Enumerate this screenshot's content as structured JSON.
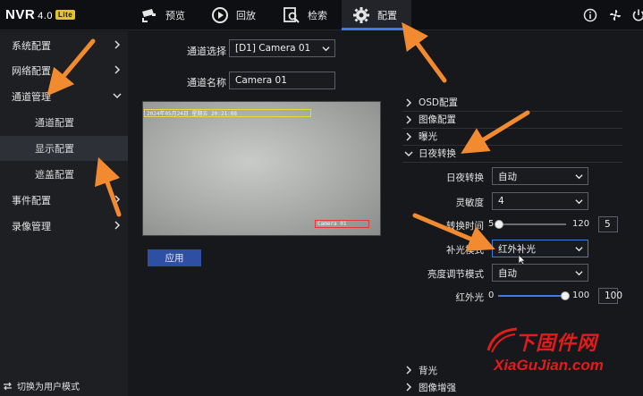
{
  "app": {
    "logo": "NVR",
    "version": "4.0",
    "edition": "Lite"
  },
  "topnav": {
    "tabs": [
      {
        "label": "预览",
        "icon": "camera-icon",
        "active": false
      },
      {
        "label": "回放",
        "icon": "playback-icon",
        "active": false
      },
      {
        "label": "检索",
        "icon": "search-doc-icon",
        "active": false
      },
      {
        "label": "配置",
        "icon": "gear-icon",
        "active": true
      }
    ],
    "right_icons": [
      "info-icon",
      "fan-icon",
      "power-icon"
    ]
  },
  "sidebar": {
    "items": [
      {
        "label": "系统配置",
        "level": 0,
        "expanded": false
      },
      {
        "label": "网络配置",
        "level": 0,
        "expanded": false
      },
      {
        "label": "通道管理",
        "level": 0,
        "expanded": true
      },
      {
        "label": "通道配置",
        "level": 1
      },
      {
        "label": "显示配置",
        "level": 1,
        "selected": true
      },
      {
        "label": "遮盖配置",
        "level": 1
      },
      {
        "label": "事件配置",
        "level": 0,
        "expanded": false
      },
      {
        "label": "录像管理",
        "level": 0,
        "expanded": false
      }
    ],
    "user_mode": "切换为用户模式"
  },
  "channel": {
    "select_label": "通道选择",
    "select_value": "[D1] Camera 01",
    "name_label": "通道名称",
    "name_value": "Camera 01"
  },
  "preview": {
    "timestamp_text": "2024年05月24日 星期五 20:21:08",
    "name_text": "Camera 01"
  },
  "apply_label": "应用",
  "sections": [
    {
      "label": "OSD配置",
      "expanded": false
    },
    {
      "label": "图像配置",
      "expanded": false
    },
    {
      "label": "曝光",
      "expanded": false
    },
    {
      "label": "日夜转换",
      "expanded": true
    },
    {
      "label": "背光",
      "expanded": false
    },
    {
      "label": "图像增强",
      "expanded": false
    }
  ],
  "daynight": {
    "mode_label": "日夜转换",
    "mode_value": "自动",
    "sensitivity_label": "灵敏度",
    "sensitivity_value": "4",
    "switch_time_label": "转换时间",
    "switch_time_min": "5",
    "switch_time_max": "120",
    "switch_time_value": "5",
    "fill_light_label": "补光模式",
    "fill_light_value": "红外补光",
    "brightness_label": "亮度调节模式",
    "brightness_value": "自动",
    "ir_label": "红外光",
    "ir_min": "0",
    "ir_max": "100",
    "ir_value": "100"
  },
  "watermark": {
    "title": "下固件网",
    "url": "XiaGuJian.com"
  },
  "colors": {
    "accent": "#3d7be6",
    "annotation_arrow": "#f28a30",
    "watermark": "#e21b1b"
  }
}
